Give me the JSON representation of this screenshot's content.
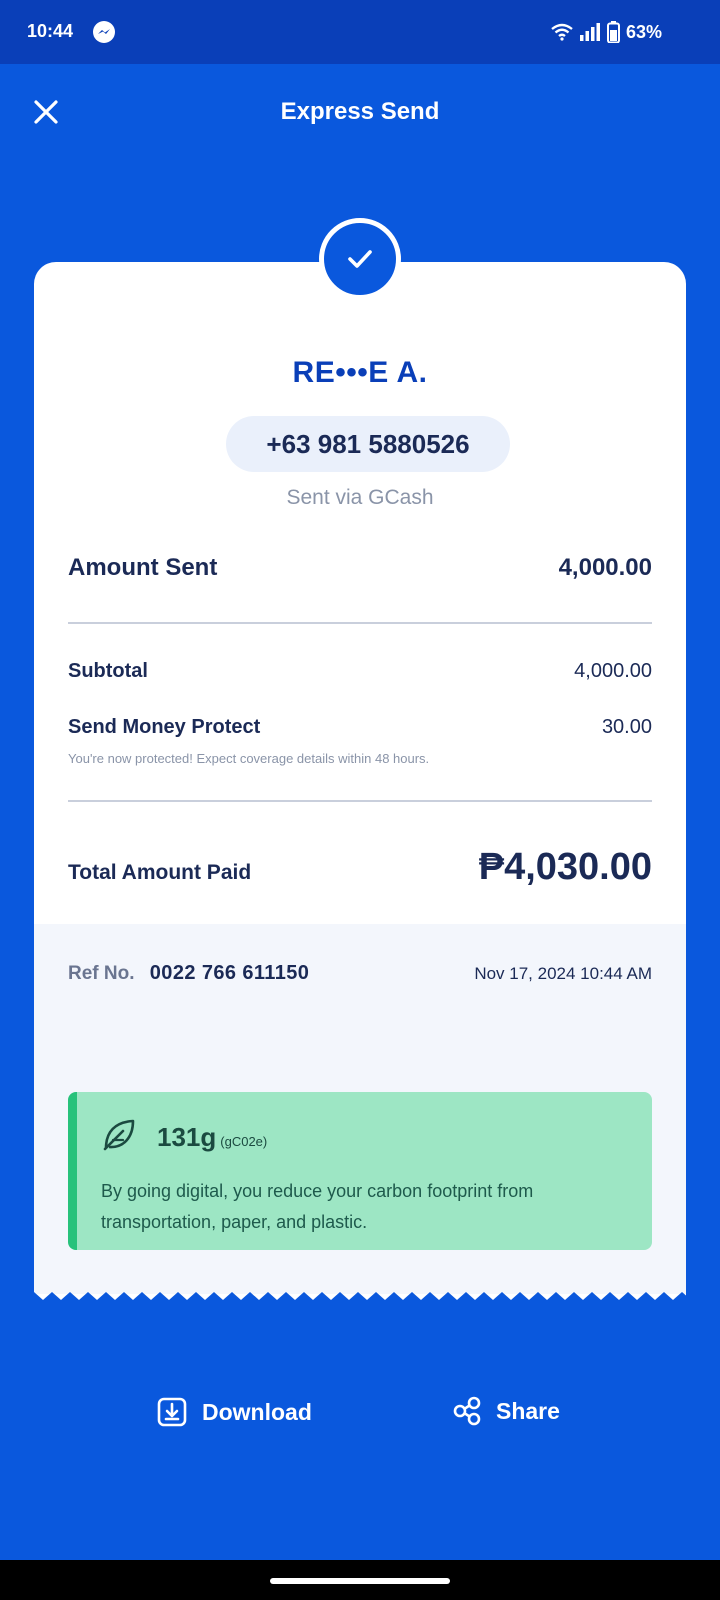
{
  "status_bar": {
    "time": "10:44",
    "battery": "63%"
  },
  "header": {
    "title": "Express Send"
  },
  "recipient": {
    "name": "RE•••E A.",
    "phone": "+63 981 5880526",
    "via": "Sent via GCash"
  },
  "summary": {
    "amount_sent_label": "Amount Sent",
    "amount_sent_value": "4,000.00",
    "subtotal_label": "Subtotal",
    "subtotal_value": "4,000.00",
    "protect_label": "Send Money Protect",
    "protect_value": "30.00",
    "protect_note": "You're now protected! Expect coverage details within 48 hours.",
    "total_label": "Total Amount Paid",
    "total_value": "₱4,030.00"
  },
  "reference": {
    "label": "Ref No.",
    "number": "0022 766 611150",
    "datetime": "Nov 17, 2024 10:44 AM"
  },
  "eco": {
    "amount": "131g",
    "unit": "(gC02e)",
    "message": "By going digital, you reduce your carbon footprint from transportation, paper, and plastic."
  },
  "actions": {
    "download": "Download",
    "share": "Share"
  },
  "colors": {
    "brand_blue": "#0a58dd",
    "eco_green": "#9de6c4"
  }
}
